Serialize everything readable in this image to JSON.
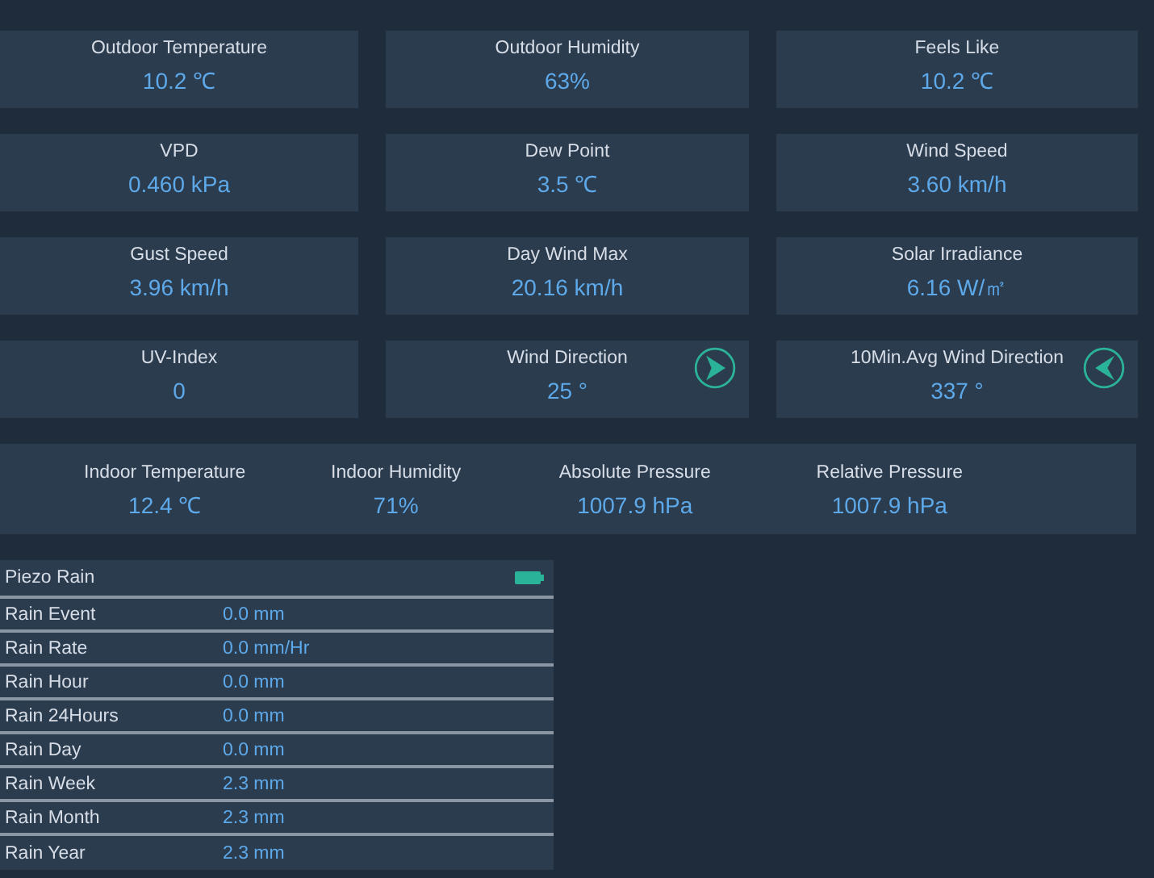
{
  "cards": [
    {
      "label": "Outdoor Temperature",
      "value": "10.2 ℃",
      "kind": "plain"
    },
    {
      "label": "Outdoor Humidity",
      "value": "63%",
      "kind": "plain"
    },
    {
      "label": "Feels Like",
      "value": "10.2 ℃",
      "kind": "plain"
    },
    {
      "label": "VPD",
      "value": "0.460 kPa",
      "kind": "plain"
    },
    {
      "label": "Dew Point",
      "value": "3.5 ℃",
      "kind": "plain"
    },
    {
      "label": "Wind Speed",
      "value": "3.60 km/h",
      "kind": "plain"
    },
    {
      "label": "Gust Speed",
      "value": "3.96 km/h",
      "kind": "plain"
    },
    {
      "label": "Day Wind Max",
      "value": "20.16 km/h",
      "kind": "plain"
    },
    {
      "label": "Solar Irradiance",
      "value": "6.16 W/㎡",
      "kind": "plain"
    },
    {
      "label": "UV-Index",
      "value": "0",
      "kind": "plain"
    },
    {
      "label": "Wind Direction",
      "value": "25 °",
      "kind": "direction"
    },
    {
      "label": "10Min.Avg Wind Direction",
      "value": "337 °",
      "kind": "direction"
    }
  ],
  "indoor": [
    {
      "label": "Indoor Temperature",
      "value": "12.4 ℃"
    },
    {
      "label": "Indoor Humidity",
      "value": "71%"
    },
    {
      "label": "Absolute Pressure",
      "value": "1007.9 hPa"
    },
    {
      "label": "Relative Pressure",
      "value": "1007.9 hPa"
    }
  ],
  "rain": {
    "title": "Piezo Rain",
    "rows": [
      {
        "label": "Rain Event",
        "value": "0.0 mm"
      },
      {
        "label": "Rain Rate",
        "value": "0.0 mm/Hr"
      },
      {
        "label": "Rain Hour",
        "value": "0.0 mm"
      },
      {
        "label": "Rain 24Hours",
        "value": "0.0 mm"
      },
      {
        "label": "Rain Day",
        "value": "0.0 mm"
      },
      {
        "label": "Rain Week",
        "value": "2.3 mm"
      },
      {
        "label": "Rain Month",
        "value": "2.3 mm"
      },
      {
        "label": "Rain Year",
        "value": "2.3 mm"
      }
    ]
  }
}
